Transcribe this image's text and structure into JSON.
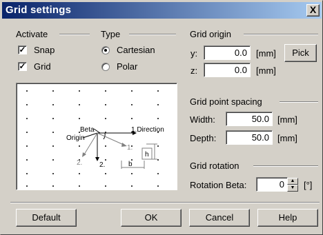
{
  "window": {
    "title": "Grid settings",
    "close_label": "X"
  },
  "activate": {
    "label": "Activate",
    "snap": {
      "label": "Snap",
      "checked": true
    },
    "grid": {
      "label": "Grid",
      "checked": true
    },
    "check_mark": "✓"
  },
  "type": {
    "label": "Type",
    "cartesian": {
      "label": "Cartesian",
      "selected": true
    },
    "polar": {
      "label": "Polar",
      "selected": false
    }
  },
  "grid_origin": {
    "label": "Grid origin",
    "y": {
      "label": "y:",
      "value": "0.0",
      "unit": "[mm]"
    },
    "z": {
      "label": "z:",
      "value": "0.0",
      "unit": "[mm]"
    },
    "pick_label": "Pick"
  },
  "grid_point_spacing": {
    "label": "Grid point spacing",
    "width": {
      "label": "Width:",
      "value": "50.0",
      "unit": "[mm]"
    },
    "depth": {
      "label": "Depth:",
      "value": "50.0",
      "unit": "[mm]"
    }
  },
  "grid_rotation": {
    "label": "Grid rotation",
    "beta": {
      "label": "Rotation Beta:",
      "value": "0",
      "unit": "[°]"
    }
  },
  "preview": {
    "beta": "Beta",
    "origin": "Origin",
    "direction1": "1.Direction",
    "direction2": "2.",
    "one": "1.",
    "two": "2.",
    "h": "h",
    "b": "b"
  },
  "buttons": {
    "default": "Default",
    "ok": "OK",
    "cancel": "Cancel",
    "help": "Help"
  },
  "colors": {
    "title_start": "#0a246a",
    "title_end": "#a6caf0",
    "face": "#d4d0c8"
  }
}
